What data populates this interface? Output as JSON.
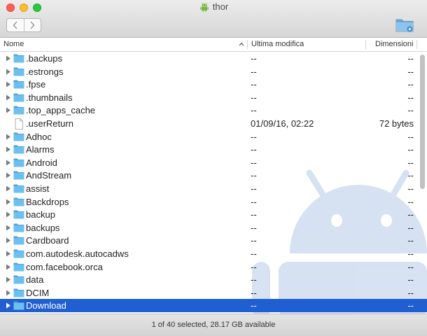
{
  "window": {
    "title": "thor"
  },
  "columns": {
    "name": "Nome",
    "modified": "Ultima modifica",
    "size": "Dimensioni"
  },
  "files": [
    {
      "name": ".backups",
      "modified": "--",
      "size": "--",
      "kind": "folder"
    },
    {
      "name": ".estrongs",
      "modified": "--",
      "size": "--",
      "kind": "folder"
    },
    {
      "name": ".fpse",
      "modified": "--",
      "size": "--",
      "kind": "folder"
    },
    {
      "name": ".thumbnails",
      "modified": "--",
      "size": "--",
      "kind": "folder"
    },
    {
      "name": ".top_apps_cache",
      "modified": "--",
      "size": "--",
      "kind": "folder"
    },
    {
      "name": ".userReturn",
      "modified": "01/09/16, 02:22",
      "size": "72 bytes",
      "kind": "file"
    },
    {
      "name": "Adhoc",
      "modified": "--",
      "size": "--",
      "kind": "folder"
    },
    {
      "name": "Alarms",
      "modified": "--",
      "size": "--",
      "kind": "folder"
    },
    {
      "name": "Android",
      "modified": "--",
      "size": "--",
      "kind": "folder"
    },
    {
      "name": "AndStream",
      "modified": "--",
      "size": "--",
      "kind": "folder"
    },
    {
      "name": "assist",
      "modified": "--",
      "size": "--",
      "kind": "folder"
    },
    {
      "name": "Backdrops",
      "modified": "--",
      "size": "--",
      "kind": "folder"
    },
    {
      "name": "backup",
      "modified": "--",
      "size": "--",
      "kind": "folder"
    },
    {
      "name": "backups",
      "modified": "--",
      "size": "--",
      "kind": "folder"
    },
    {
      "name": "Cardboard",
      "modified": "--",
      "size": "--",
      "kind": "folder"
    },
    {
      "name": "com.autodesk.autocadws",
      "modified": "--",
      "size": "--",
      "kind": "folder"
    },
    {
      "name": "com.facebook.orca",
      "modified": "--",
      "size": "--",
      "kind": "folder"
    },
    {
      "name": "data",
      "modified": "--",
      "size": "--",
      "kind": "folder"
    },
    {
      "name": "DCIM",
      "modified": "--",
      "size": "--",
      "kind": "folder"
    },
    {
      "name": "Download",
      "modified": "--",
      "size": "--",
      "kind": "folder",
      "selected": true
    }
  ],
  "status": {
    "text": "1 of 40 selected, 28.17 GB available"
  },
  "icons": {
    "back": "chevron-left-icon",
    "forward": "chevron-right-icon",
    "new_folder": "new-folder-icon",
    "title": "android-icon",
    "sort": "sort-ascending-icon",
    "folder": "folder-icon",
    "file": "document-icon",
    "disclosure": "disclosure-triangle-icon"
  },
  "colors": {
    "selection": "#1f5fd1",
    "folder": "#5bb5ea",
    "watermark": "#c9d9ee"
  }
}
